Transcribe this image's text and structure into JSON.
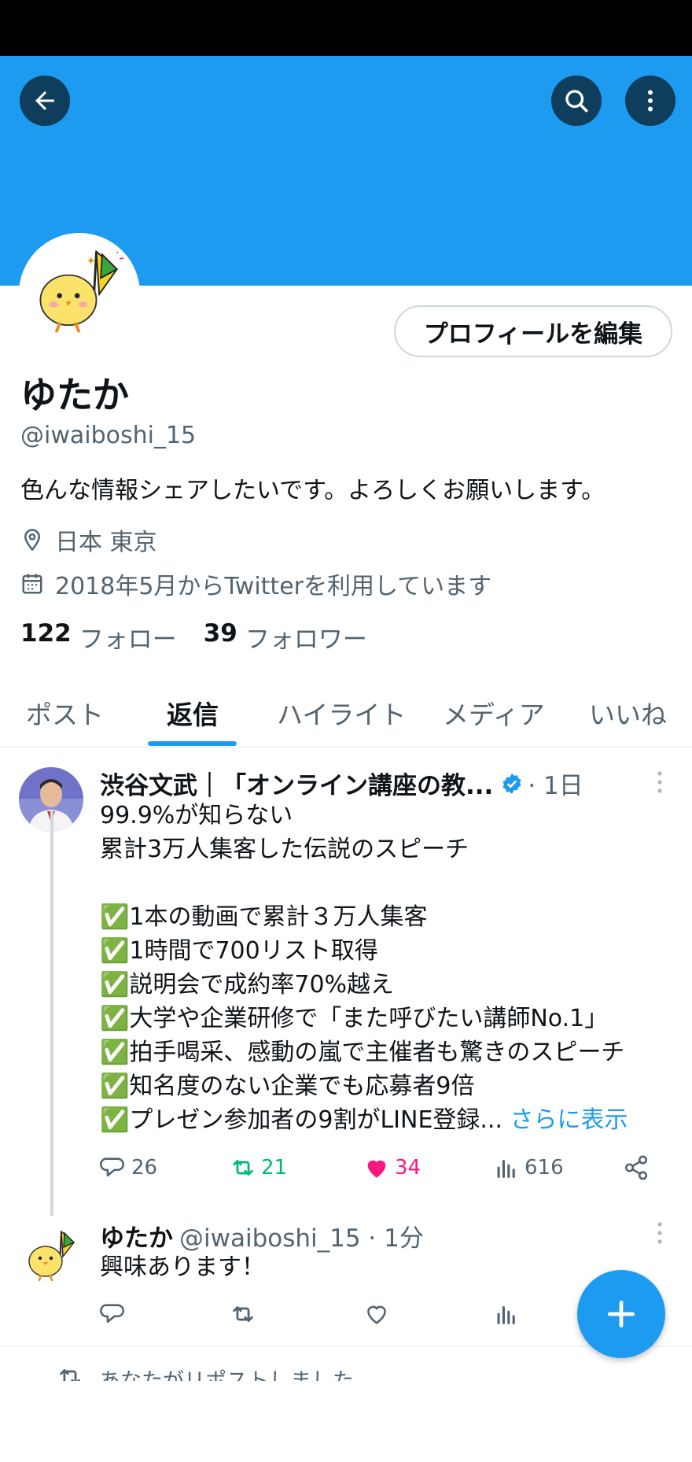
{
  "profile": {
    "edit_label": "プロフィールを編集",
    "name": "ゆたか",
    "handle": "@iwaiboshi_15",
    "bio": "色んな情報シェアしたいです。よろしくお願いします。",
    "location": "日本 東京",
    "joined": "2018年5月からTwitterを利用しています",
    "following_count": "122",
    "following_label": "フォロー",
    "followers_count": "39",
    "followers_label": "フォロワー"
  },
  "tabs": [
    {
      "label": "ポスト",
      "active": false
    },
    {
      "label": "返信",
      "active": true
    },
    {
      "label": "ハイライト",
      "active": false
    },
    {
      "label": "メディア",
      "active": false
    },
    {
      "label": "いいね",
      "active": false
    }
  ],
  "post1": {
    "author": "渋谷文武｜「オンライン講座の教...",
    "time": "· 1日",
    "lines": [
      "99.9%が知らない",
      "累計3万人集客した伝説のスピーチ",
      "",
      "✅1本の動画で累計３万人集客",
      "✅1時間で700リスト取得",
      "✅説明会で成約率70%越え",
      "✅大学や企業研修で「また呼びたい講師No.1」",
      "✅拍手喝采、感動の嵐で主催者も驚きのスピーチ",
      "✅知名度のない企業でも応募者9倍",
      "✅プレゼン参加者の9割がLINE登録..."
    ],
    "show_more": "さらに表示",
    "replies": "26",
    "reposts": "21",
    "likes": "34",
    "views": "616"
  },
  "post2": {
    "author": "ゆたか",
    "handle_time": "@iwaiboshi_15 · 1分",
    "text": "興味あります！"
  },
  "repost_note": "あなたがリポストしました",
  "colors": {
    "banner": "#1d9bf0",
    "accent": "#1d9bf0",
    "repost": "#00ba7c",
    "like": "#f91880",
    "secondary_text": "#536471"
  },
  "icons": [
    "back-arrow-icon",
    "search-icon",
    "more-vertical-icon",
    "location-pin-icon",
    "calendar-icon",
    "verified-badge-icon",
    "reply-icon",
    "repost-icon",
    "like-heart-icon",
    "views-chart-icon",
    "share-icon",
    "compose-plus-icon"
  ]
}
